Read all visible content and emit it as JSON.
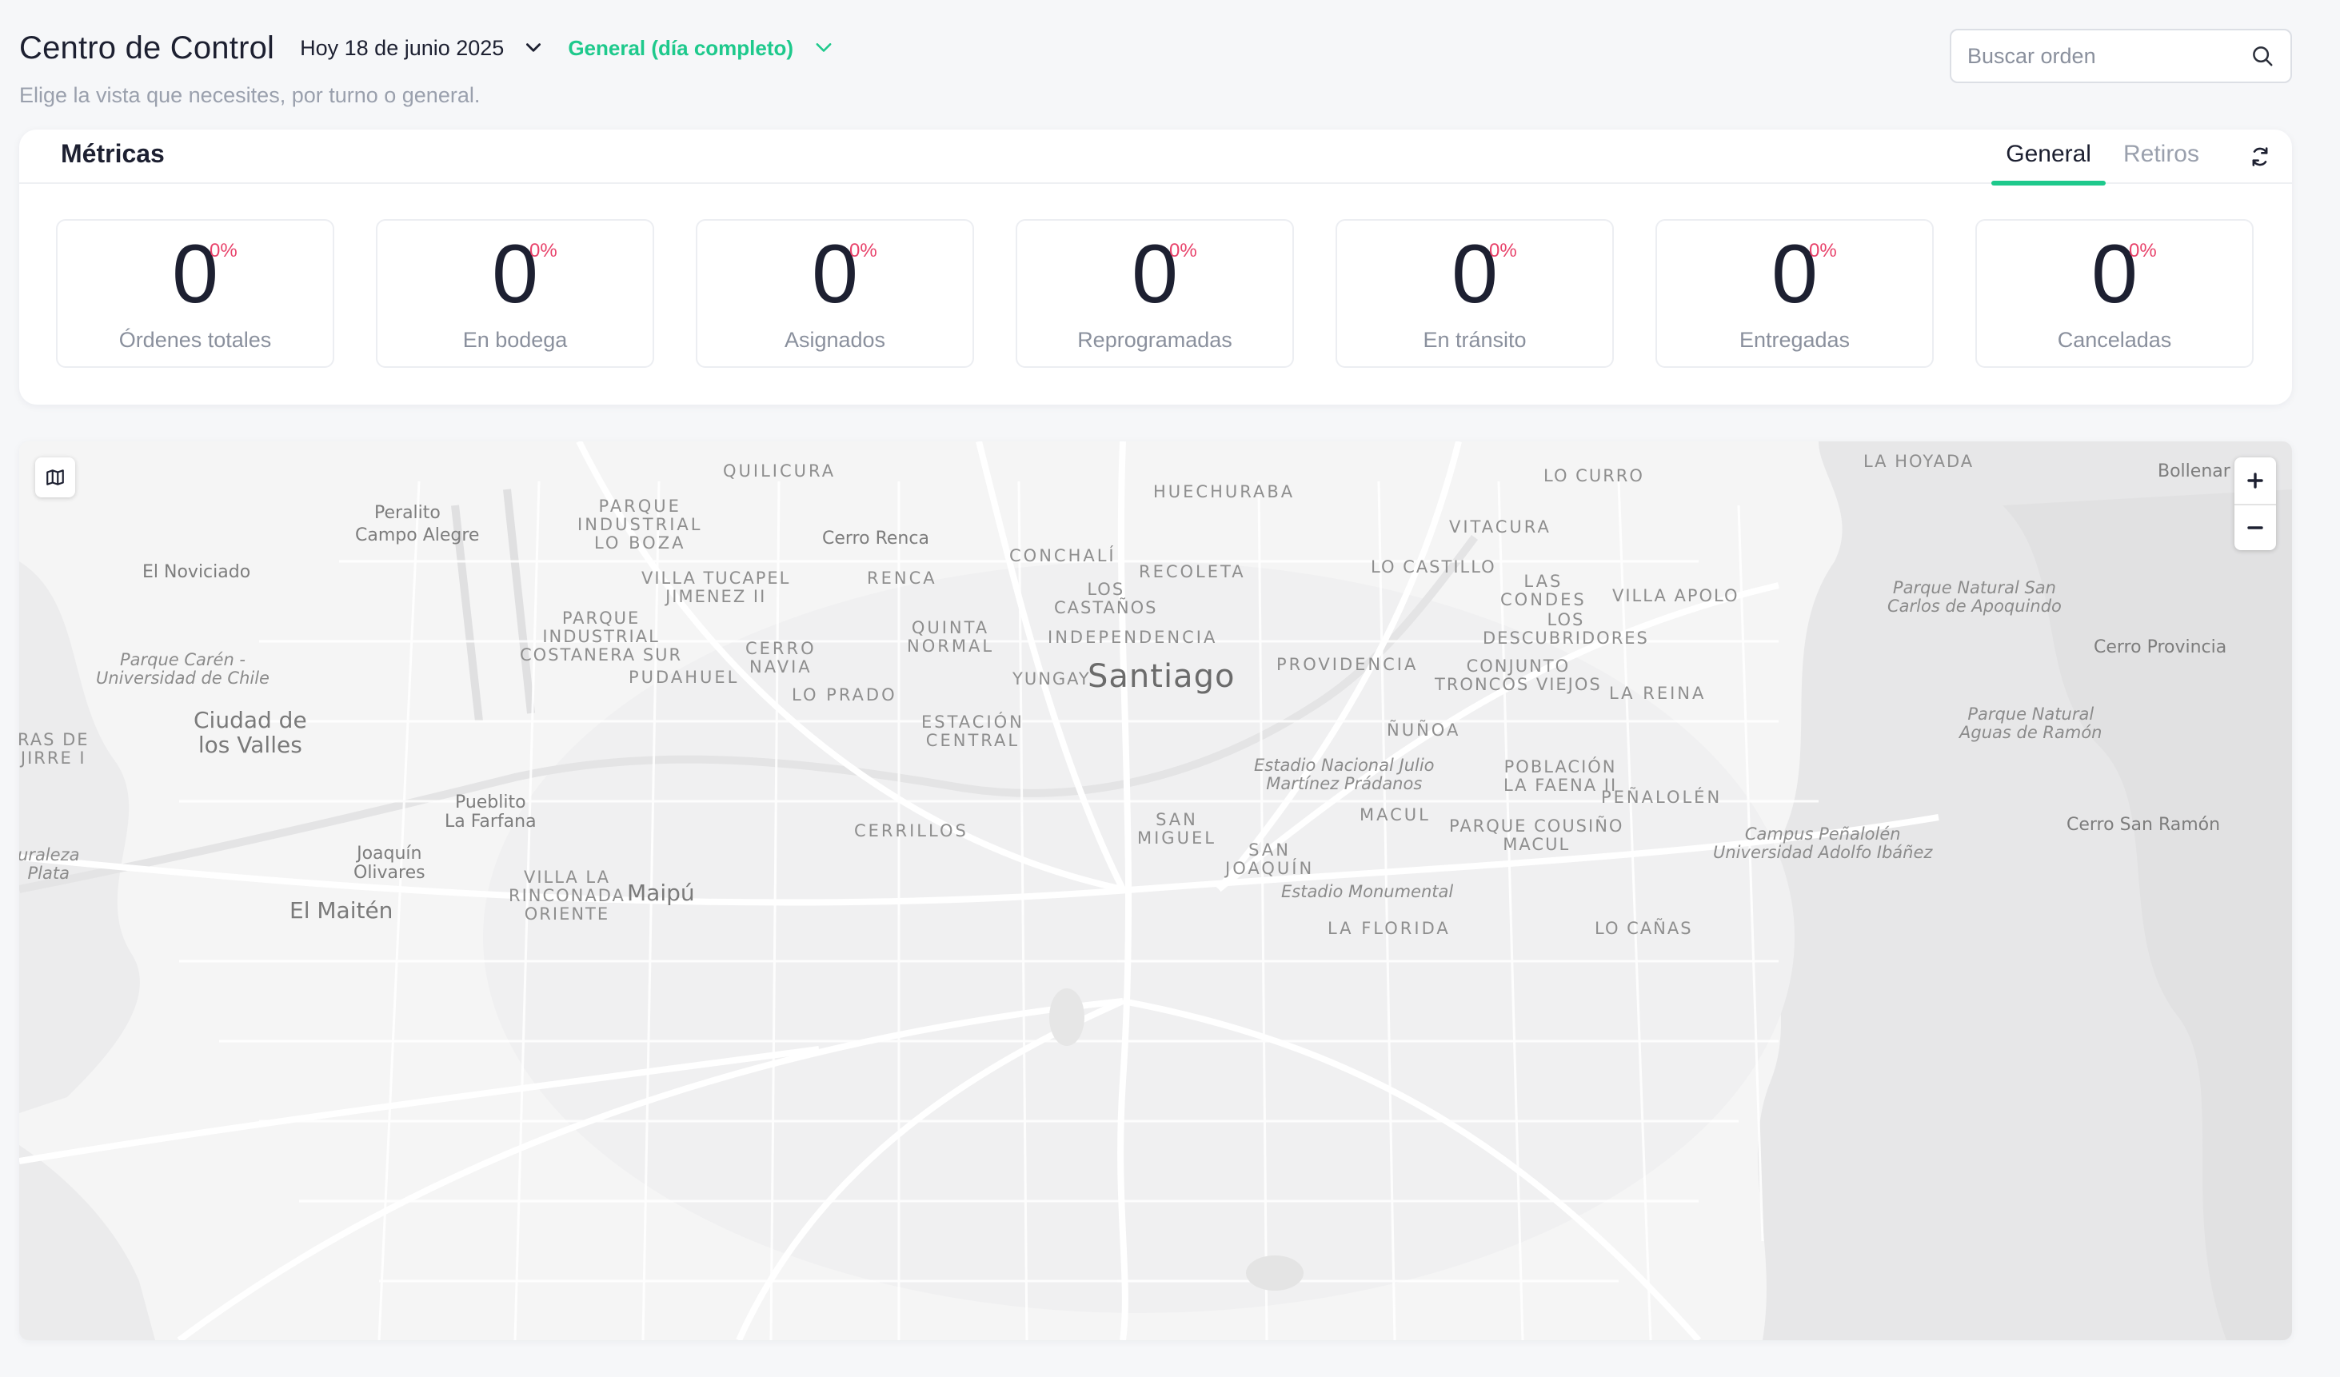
{
  "header": {
    "title": "Centro de Control",
    "date_label": "Hoy 18 de junio 2025",
    "shift_label": "General (día completo)",
    "subtitle": "Elige la vista que necesites, por turno o general.",
    "accent_color": "#1ec98c"
  },
  "search": {
    "placeholder": "Buscar orden",
    "value": "",
    "icon": "search-icon"
  },
  "metrics": {
    "title": "Métricas",
    "tabs": [
      {
        "label": "General",
        "active": true
      },
      {
        "label": "Retiros",
        "active": false
      }
    ],
    "refresh_icon": "refresh-icon",
    "pct_color": "#e8436b",
    "items": [
      {
        "value": "0",
        "pct": "0%",
        "label": "Órdenes totales"
      },
      {
        "value": "0",
        "pct": "0%",
        "label": "En bodega"
      },
      {
        "value": "0",
        "pct": "0%",
        "label": "Asignados"
      },
      {
        "value": "0",
        "pct": "0%",
        "label": "Reprogramadas"
      },
      {
        "value": "0",
        "pct": "0%",
        "label": "En tránsito"
      },
      {
        "value": "0",
        "pct": "0%",
        "label": "Entregadas"
      },
      {
        "value": "0",
        "pct": "0%",
        "label": "Canceladas"
      }
    ]
  },
  "map": {
    "layer_icon": "map-icon",
    "zoom_in": "+",
    "zoom_out": "−",
    "labels": [
      {
        "text": "QUILICURA",
        "kind": "caps"
      },
      {
        "text": "HUECHURABA",
        "kind": "caps"
      },
      {
        "text": "LO CURRO",
        "kind": "small"
      },
      {
        "text": "LA HOYADA",
        "kind": "small"
      },
      {
        "text": "Bollenar",
        "kind": "place"
      },
      {
        "text": "Peralito",
        "kind": "place"
      },
      {
        "text": "PARQUE\nINDUSTRIAL\nLO BOZA",
        "kind": "caps"
      },
      {
        "text": "Campo Alegre",
        "kind": "place"
      },
      {
        "text": "Cerro Renca",
        "kind": "place"
      },
      {
        "text": "VITACURA",
        "kind": "caps"
      },
      {
        "text": "CONCHALÍ",
        "kind": "caps"
      },
      {
        "text": "RECOLETA",
        "kind": "caps"
      },
      {
        "text": "LO CASTILLO",
        "kind": "small"
      },
      {
        "text": "El Noviciado",
        "kind": "place"
      },
      {
        "text": "VILLA TUCAPEL\nJIMENEZ II",
        "kind": "small"
      },
      {
        "text": "RENCA",
        "kind": "caps"
      },
      {
        "text": "LOS\nCASTAÑOS",
        "kind": "small"
      },
      {
        "text": "LAS\nCONDES",
        "kind": "caps"
      },
      {
        "text": "VILLA APOLO",
        "kind": "small"
      },
      {
        "text": "Parque Natural San\nCarlos de Apoquindo",
        "kind": "park"
      },
      {
        "text": "PARQUE\nINDUSTRIAL\nCOSTANERA SUR",
        "kind": "small"
      },
      {
        "text": "QUINTA\nNORMAL",
        "kind": "caps"
      },
      {
        "text": "INDEPENDENCIA",
        "kind": "caps"
      },
      {
        "text": "LOS\nDESCUBRIDORES",
        "kind": "small"
      },
      {
        "text": "CERRO\nNAVIA",
        "kind": "caps"
      },
      {
        "text": "Cerro Provincia",
        "kind": "place"
      },
      {
        "text": "Parque Carén -\nUniversidad de Chile",
        "kind": "park"
      },
      {
        "text": "PROVIDENCIA",
        "kind": "caps"
      },
      {
        "text": "CONJUNTO\nTRONCOS VIEJOS",
        "kind": "small"
      },
      {
        "text": "PUDAHUEL",
        "kind": "caps"
      },
      {
        "text": "YUNGAY",
        "kind": "small"
      },
      {
        "text": "Santiago",
        "kind": "city"
      },
      {
        "text": "LO PRADO",
        "kind": "caps"
      },
      {
        "text": "LA REINA",
        "kind": "caps"
      },
      {
        "text": "Ciudad de\nlos Valles",
        "kind": "town"
      },
      {
        "text": "ESTACIÓN\nCENTRAL",
        "kind": "caps"
      },
      {
        "text": "Parque Natural\nAguas de Ramón",
        "kind": "park"
      },
      {
        "text": "ÑUÑOA",
        "kind": "caps"
      },
      {
        "text": "RAS DE\nJIRRE I",
        "kind": "small"
      },
      {
        "text": "Estadio Nacional Julio\nMartínez Prádanos",
        "kind": "park"
      },
      {
        "text": "POBLACIÓN\nLA FAENA II",
        "kind": "small"
      },
      {
        "text": "PEÑALOLÉN",
        "kind": "caps"
      },
      {
        "text": "Pueblito\nLa Farfana",
        "kind": "place"
      },
      {
        "text": "MACUL",
        "kind": "caps"
      },
      {
        "text": "SAN\nMIGUEL",
        "kind": "caps"
      },
      {
        "text": "PARQUE COUSIÑO\nMACUL",
        "kind": "small"
      },
      {
        "text": "Cerro San Ramón",
        "kind": "place"
      },
      {
        "text": "CERRILLOS",
        "kind": "caps"
      },
      {
        "text": "Campus Peñalolén\nUniversidad Adolfo Ibáñez",
        "kind": "park"
      },
      {
        "text": "uraleza\nPlata",
        "kind": "park"
      },
      {
        "text": "Joaquín\nOlivares",
        "kind": "place"
      },
      {
        "text": "SAN\nJOAQUÍN",
        "kind": "caps"
      },
      {
        "text": "VILLA LA\nRINCONADA\nORIENTE",
        "kind": "small"
      },
      {
        "text": "Maipú",
        "kind": "town"
      },
      {
        "text": "Estadio Monumental",
        "kind": "park"
      },
      {
        "text": "El Maitén",
        "kind": "town"
      },
      {
        "text": "LA FLORIDA",
        "kind": "caps"
      },
      {
        "text": "LO CAÑAS",
        "kind": "small"
      }
    ]
  }
}
